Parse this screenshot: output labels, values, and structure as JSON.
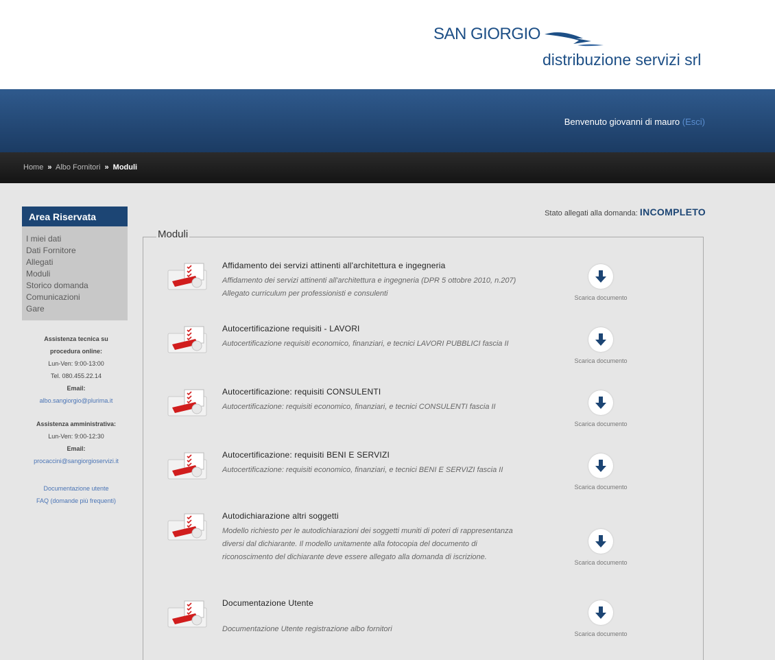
{
  "logo": {
    "line1": "SAN GIORGIO",
    "line2": "distribuzione servizi srl",
    "alt": "San Giorgio distribuzione servizi srl logo"
  },
  "welcome": {
    "text": "Benvenuto giovanni di mauro",
    "logout": "(Esci)"
  },
  "breadcrumb": {
    "home": "Home",
    "sep": "»",
    "albo": "Albo Fornitori",
    "current": "Moduli"
  },
  "sidebar": {
    "title": "Area Riservata",
    "items": [
      {
        "label": "I miei dati"
      },
      {
        "label": "Dati Fornitore"
      },
      {
        "label": "Allegati"
      },
      {
        "label": "Moduli"
      },
      {
        "label": "Storico domanda"
      },
      {
        "label": "Comunicazioni"
      },
      {
        "label": "Gare"
      }
    ],
    "tech_title_1": "Assistenza tecnica su",
    "tech_title_2": "procedura online:",
    "tech_hours": "Lun-Ven: 9:00-13:00",
    "tech_tel": "Tel. 080.455.22.14",
    "tech_email_label": "Email:",
    "tech_email": "albo.sangiorgio@plurima.it",
    "admin_title": "Assistenza amministrativa:",
    "admin_hours": "Lun-Ven: 9:00-12:30",
    "admin_email_label": "Email:",
    "admin_email": "procaccini@sangiorgioservizi.it",
    "doc_link": "Documentazione utente",
    "faq_link": "FAQ (domande più frequenti)"
  },
  "stato": {
    "label": "Stato allegati alla domanda:",
    "value": "INCOMPLETO"
  },
  "moduli": {
    "legend": "Moduli",
    "download_label": "Scarica documento",
    "items": [
      {
        "title": "Affidamento dei servizi attinenti all'architettura e ingegneria",
        "desc": "Affidamento dei servizi attinenti all'architettura e ingegneria (DPR 5 ottobre 2010, n.207) Allegato curriculum per professionisti e consulenti"
      },
      {
        "title": "Autocertificazione requisiti - LAVORI",
        "desc": "Autocertificazione requisiti economico, finanziari, e tecnici LAVORI PUBBLICI fascia II"
      },
      {
        "title": "Autocertificazione: requisiti CONSULENTI",
        "desc": "Autocertificazione: requisiti economico, finanziari, e tecnici CONSULENTI fascia II"
      },
      {
        "title": "Autocertificazione: requisiti BENI E SERVIZI",
        "desc": "Autocertificazione: requisiti economico, finanziari, e tecnici BENI E SERVIZI fascia II"
      },
      {
        "title": "Autodichiarazione altri soggetti",
        "desc": "Modello richiesto per le autodichiarazioni dei soggetti muniti di poteri di rappresentanza diversi dal dichiarante. Il modello unitamente alla fotocopia del documento di riconoscimento del dichiarante deve essere allegato alla domanda di iscrizione."
      },
      {
        "title": "Documentazione Utente",
        "desc": "Documentazione Utente registrazione albo fornitori"
      }
    ]
  }
}
